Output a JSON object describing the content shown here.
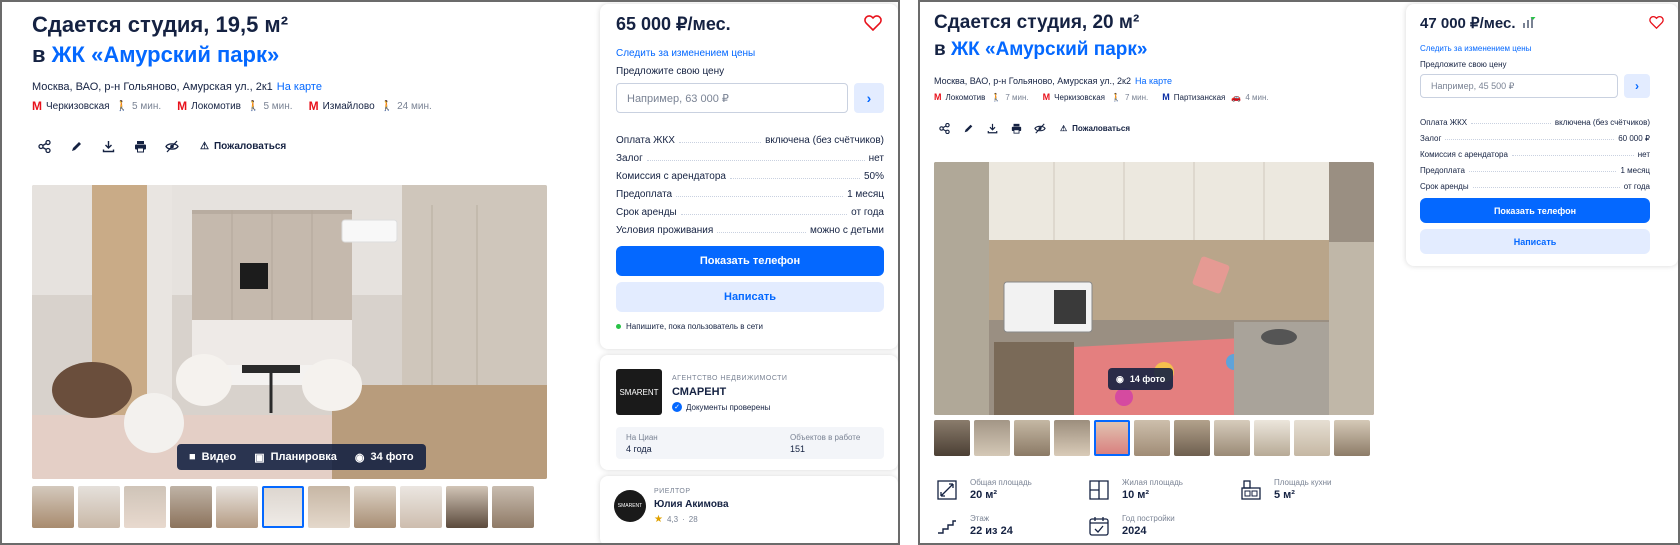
{
  "listing_a": {
    "title_line1": "Сдается студия, 19,5 м²",
    "title_prefix": "в",
    "title_complex": "ЖК «Амурский парк»",
    "address": "Москва, ВАО, р-н Гольяново, Амурская ул., 2к1",
    "map_link": "На карте",
    "metro": [
      {
        "name": "Черкизовская",
        "time": "5 мин."
      },
      {
        "name": "Локомотив",
        "time": "5 мин."
      },
      {
        "name": "Измайлово",
        "time": "24 мин."
      }
    ],
    "complain_label": "Пожаловаться",
    "media": {
      "video": "Видео",
      "plan": "Планировка",
      "photos": "34 фото"
    },
    "price": "65 000 ₽/мес.",
    "follow_price": "Следить за изменением цены",
    "offer_label": "Предложите свою цену",
    "offer_placeholder": "Например, 63 000 ₽",
    "terms": [
      {
        "k": "Оплата ЖКХ",
        "v": "включена (без счётчиков)"
      },
      {
        "k": "Залог",
        "v": "нет"
      },
      {
        "k": "Комиссия с арендатора",
        "v": "50%"
      },
      {
        "k": "Предоплата",
        "v": "1 месяц"
      },
      {
        "k": "Срок аренды",
        "v": "от года"
      },
      {
        "k": "Условия проживания",
        "v": "можно с детьми"
      }
    ],
    "show_phone": "Показать телефон",
    "write": "Написать",
    "online_note": "Напишите, пока пользователь в сети",
    "agency": {
      "logo_text": "SMARENT",
      "kind": "АГЕНТСТВО НЕДВИЖИМОСТИ",
      "name": "СМАРЕНТ",
      "verified": "Документы проверены",
      "on_cian_label": "На Циан",
      "on_cian_value": "4 года",
      "objects_label": "Объектов в работе",
      "objects_value": "151"
    },
    "realtor": {
      "logo_text": "SMARENT",
      "kind": "РИЕЛТОР",
      "name": "Юлия Акимова",
      "rating": "4,3",
      "reviews": "28"
    }
  },
  "listing_b": {
    "title_line1": "Сдается студия, 20 м²",
    "title_prefix": "в",
    "title_complex": "ЖК «Амурский парк»",
    "address": "Москва, ВАО, р-н Гольяново, Амурская ул., 2к2",
    "map_link": "На карте",
    "metro": [
      {
        "name": "Локомотив",
        "time": "7 мин.",
        "line": "red"
      },
      {
        "name": "Черкизовская",
        "time": "7 мин.",
        "line": "red"
      },
      {
        "name": "Партизанская",
        "time": "4 мин.",
        "line": "blue"
      }
    ],
    "complain_label": "Пожаловаться",
    "media": {
      "photos": "14 фото"
    },
    "price": "47 000 ₽/мес.",
    "follow_price": "Следить за изменением цены",
    "offer_label": "Предложите свою цену",
    "offer_placeholder": "Например, 45 500 ₽",
    "terms": [
      {
        "k": "Оплата ЖКХ",
        "v": "включена (без счётчиков)"
      },
      {
        "k": "Залог",
        "v": "60 000 ₽"
      },
      {
        "k": "Комиссия с арендатора",
        "v": "нет"
      },
      {
        "k": "Предоплата",
        "v": "1 месяц"
      },
      {
        "k": "Срок аренды",
        "v": "от года"
      }
    ],
    "show_phone": "Показать телефон",
    "write": "Написать",
    "features": [
      {
        "label": "Общая площадь",
        "value": "20 м²",
        "icon": "total-area-icon"
      },
      {
        "label": "Жилая площадь",
        "value": "10 м²",
        "icon": "living-area-icon"
      },
      {
        "label": "Площадь кухни",
        "value": "5 м²",
        "icon": "kitchen-area-icon"
      },
      {
        "label": "Этаж",
        "value": "22 из 24",
        "icon": "floor-icon"
      },
      {
        "label": "Год постройки",
        "value": "2024",
        "icon": "build-year-icon"
      }
    ]
  },
  "colors": {
    "brand": "#0468ff",
    "heart": "#e8111b",
    "text": "#152242"
  }
}
